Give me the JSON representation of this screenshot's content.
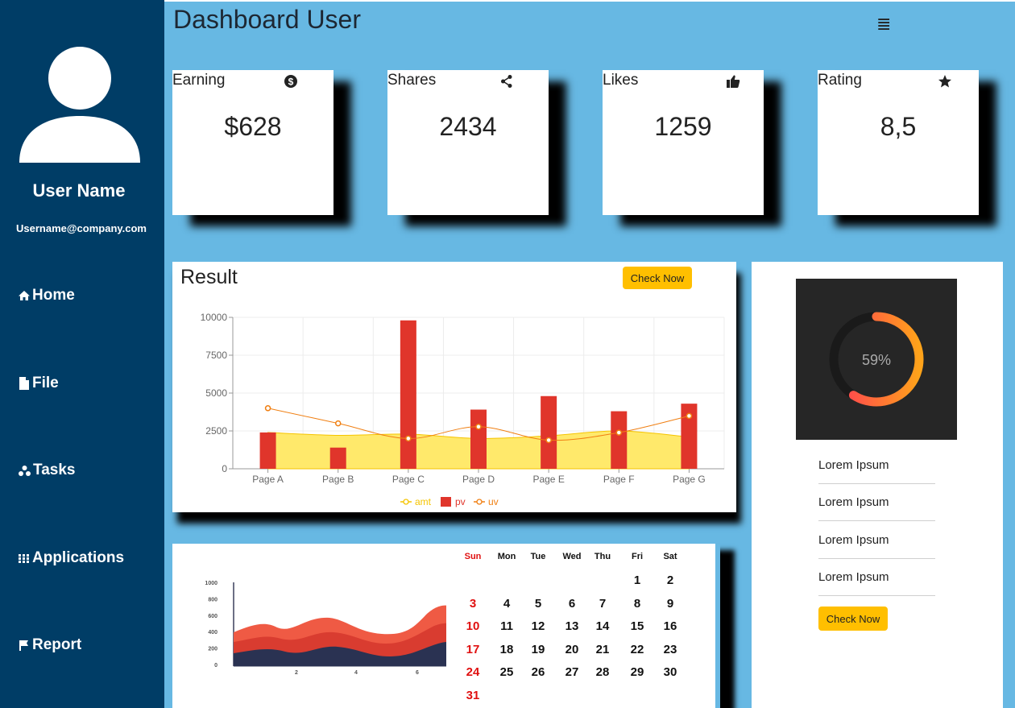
{
  "sidebar": {
    "user_name": "User Name",
    "user_email": "Username@company.com",
    "nav": [
      {
        "label": "Home",
        "icon": "home-icon"
      },
      {
        "label": "File",
        "icon": "file-icon"
      },
      {
        "label": "Tasks",
        "icon": "tasks-icon"
      },
      {
        "label": "Applications",
        "icon": "apps-grid-icon"
      },
      {
        "label": "Report",
        "icon": "flag-icon"
      }
    ]
  },
  "header": {
    "title": "Dashboard User",
    "menu_icon": "≣"
  },
  "stats": [
    {
      "label": "Earning",
      "value": "$628",
      "icon": "dollar-icon"
    },
    {
      "label": "Shares",
      "value": "2434",
      "icon": "share-icon"
    },
    {
      "label": "Likes",
      "value": "1259",
      "icon": "thumbs-up-icon"
    },
    {
      "label": "Rating",
      "value": "8,5",
      "icon": "star-icon"
    }
  ],
  "result": {
    "title": "Result",
    "button_label": "Check Now"
  },
  "colors": {
    "sidebar": "#003d66",
    "main_bg": "#67b8e3",
    "button": "#ffbf00",
    "bar_pv": "#e0352b",
    "line_uv": "#f07f12",
    "area_amt": "#ffe96b",
    "legend_amt": "#f5c400"
  },
  "chart_data": {
    "type": "bar",
    "categories": [
      "Page A",
      "Page B",
      "Page C",
      "Page D",
      "Page E",
      "Page F",
      "Page G"
    ],
    "series": [
      {
        "name": "amt",
        "type": "area",
        "values": [
          2400,
          2210,
          2290,
          2000,
          2181,
          2500,
          2100
        ]
      },
      {
        "name": "pv",
        "type": "bar",
        "values": [
          2400,
          1398,
          9800,
          3908,
          4800,
          3800,
          4300
        ]
      },
      {
        "name": "uv",
        "type": "line",
        "values": [
          4000,
          3000,
          2000,
          2780,
          1890,
          2390,
          3490
        ]
      }
    ],
    "y_ticks": [
      "0",
      "2500",
      "5000",
      "7500",
      "10000"
    ],
    "ylim": [
      0,
      10000
    ],
    "grid": true,
    "legend_position": "bottom"
  },
  "gauge": {
    "label": "59%",
    "percent": 59
  },
  "side_list": [
    "Lorem Ipsum",
    "Lorem Ipsum",
    "Lorem Ipsum",
    "Lorem Ipsum"
  ],
  "side_button_label": "Check Now",
  "mini_chart": {
    "y_ticks": [
      "0",
      "200",
      "400",
      "600",
      "800",
      "1000"
    ],
    "x_ticks": [
      "2",
      "4",
      "6"
    ]
  },
  "calendar": {
    "weekdays": [
      "Sun",
      "Mon",
      "Tue",
      "Wed",
      "Thu",
      "Fri",
      "Sat"
    ],
    "weeks": [
      [
        "",
        "",
        "",
        "",
        "",
        "1",
        "2"
      ],
      [
        "3",
        "4",
        "5",
        "6",
        "7",
        "8",
        "9"
      ],
      [
        "10",
        "11",
        "12",
        "13",
        "14",
        "15",
        "16"
      ],
      [
        "17",
        "18",
        "19",
        "20",
        "21",
        "22",
        "23"
      ],
      [
        "24",
        "25",
        "26",
        "27",
        "28",
        "29",
        "30"
      ],
      [
        "31",
        "",
        "",
        "",
        "",
        "",
        ""
      ]
    ]
  }
}
